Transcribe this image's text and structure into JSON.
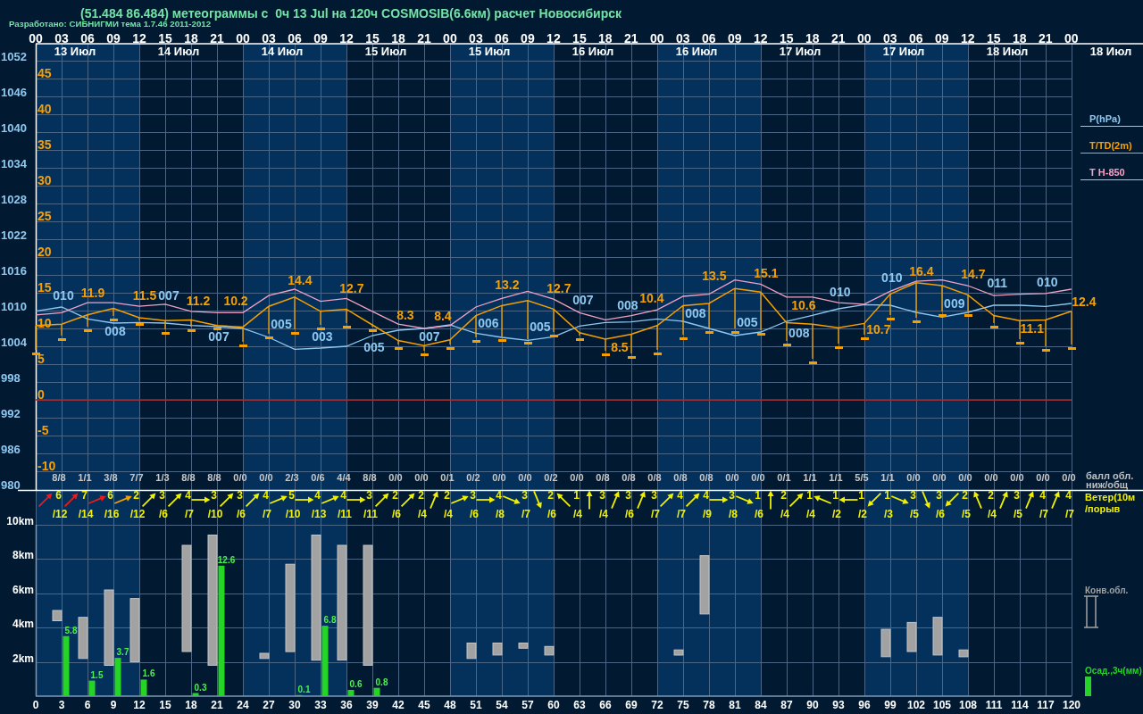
{
  "header": {
    "title": "(51.484 86.484) метеограммы с  0ч 13 Jul на 120ч COSMOSIB(6.6км) расчет Новосибирск",
    "credit": "Разработано: СИБНИГМИ тема 1.7.46 2011-2012"
  },
  "days": [
    {
      "label": "13 Июл",
      "shaded": true
    },
    {
      "label": "14 Июл",
      "shaded": false
    },
    {
      "label": "14 Июл",
      "shaded": true
    },
    {
      "label": "15 Июл",
      "shaded": false
    },
    {
      "label": "15 Июл",
      "shaded": true
    },
    {
      "label": "16 Июл",
      "shaded": false
    },
    {
      "label": "16 Июл",
      "shaded": true
    },
    {
      "label": "17 Июл",
      "shaded": false
    },
    {
      "label": "17 Июл",
      "shaded": true
    },
    {
      "label": "18 Июл",
      "shaded": false
    },
    {
      "label": "18 Июл",
      "shaded": false
    }
  ],
  "upper_panel": {
    "pressure_chart": {
      "chart_data": {
        "type": "line",
        "x": [
          0,
          3,
          6,
          9,
          12,
          15,
          18,
          21,
          24,
          27,
          30,
          33,
          36,
          39,
          42,
          45,
          48,
          51,
          54,
          57,
          60,
          63,
          66,
          69,
          72,
          75,
          78,
          81,
          84,
          87,
          90,
          93,
          96,
          99,
          102,
          105,
          108,
          111,
          114,
          117,
          120
        ],
        "xlim": [
          0,
          128.3
        ],
        "ylim": [
          980,
          1055
        ],
        "xticks": [
          {
            "value": 0,
            "label": "00"
          },
          {
            "value": 3,
            "label": "03"
          },
          {
            "value": 6,
            "label": "06"
          },
          {
            "value": 9,
            "label": "09"
          },
          {
            "value": 12,
            "label": "12"
          },
          {
            "value": 15,
            "label": "15"
          },
          {
            "value": 18,
            "label": "18"
          },
          {
            "value": 21,
            "label": "21"
          },
          {
            "value": 24,
            "label": "00"
          },
          {
            "value": 27,
            "label": "03"
          },
          {
            "value": 30,
            "label": "06"
          },
          {
            "value": 33,
            "label": "09"
          },
          {
            "value": 36,
            "label": "12"
          },
          {
            "value": 39,
            "label": "15"
          },
          {
            "value": 42,
            "label": "18"
          },
          {
            "value": 45,
            "label": "21"
          },
          {
            "value": 48,
            "label": "00"
          },
          {
            "value": 51,
            "label": "03"
          },
          {
            "value": 54,
            "label": "06"
          },
          {
            "value": 57,
            "label": "09"
          },
          {
            "value": 60,
            "label": "12"
          },
          {
            "value": 63,
            "label": "15"
          },
          {
            "value": 66,
            "label": "18"
          },
          {
            "value": 69,
            "label": "21"
          },
          {
            "value": 72,
            "label": "00"
          },
          {
            "value": 75,
            "label": "03"
          },
          {
            "value": 78,
            "label": "06"
          },
          {
            "value": 81,
            "label": "09"
          },
          {
            "value": 84,
            "label": "12"
          },
          {
            "value": 87,
            "label": "15"
          },
          {
            "value": 90,
            "label": "18"
          },
          {
            "value": 93,
            "label": "21"
          },
          {
            "value": 96,
            "label": "00"
          },
          {
            "value": 99,
            "label": "03"
          },
          {
            "value": 102,
            "label": "06"
          },
          {
            "value": 105,
            "label": "09"
          },
          {
            "value": 108,
            "label": "12"
          },
          {
            "value": 111,
            "label": "15"
          },
          {
            "value": 114,
            "label": "18"
          },
          {
            "value": 117,
            "label": "21"
          },
          {
            "value": 120,
            "label": "00"
          }
        ],
        "yticks": [
          980,
          986,
          992,
          998,
          1004,
          1010,
          1016,
          1022,
          1028,
          1034,
          1040,
          1046,
          1052
        ],
        "series": [
          {
            "name": "P(hPa)",
            "color": "#8ec8f0",
            "values": [
              1009.9,
              1010.6,
              1008.6,
              1007.9,
              1008.0,
              1007.9,
              1007.5,
              1007.3,
              1007.0,
              1005.5,
              1003.5,
              1003.7,
              1004.0,
              1005.8,
              1006.7,
              1007.0,
              1007.6,
              1006.2,
              1005.5,
              1005.0,
              1005.6,
              1007.4,
              1008.0,
              1008.1,
              1008.6,
              1008.2,
              1007.0,
              1005.8,
              1006.4,
              1008.2,
              1009.2,
              1010.3,
              1011.0,
              1010.9,
              1009.7,
              1008.9,
              1009.7,
              1010.9,
              1010.9,
              1010.7,
              1011.2
            ]
          }
        ],
        "annotations": [
          {
            "x": 3,
            "y": 1010.6,
            "text": "010"
          },
          {
            "x": 9,
            "y": 1007.9,
            "text": "008"
          },
          {
            "x": 15,
            "y": 1007.9,
            "text": "007"
          },
          {
            "x": 21,
            "y": 1007.3,
            "text": "007"
          },
          {
            "x": 27,
            "y": 1005.5,
            "text": "005"
          },
          {
            "x": 33,
            "y": 1003.7,
            "text": "003"
          },
          {
            "x": 39,
            "y": 1005.8,
            "text": "005"
          },
          {
            "x": 45,
            "y": 1007.0,
            "text": "007"
          },
          {
            "x": 51,
            "y": 1006.2,
            "text": "006"
          },
          {
            "x": 57,
            "y": 1005.0,
            "text": "005"
          },
          {
            "x": 63,
            "y": 1007.4,
            "text": "007"
          },
          {
            "x": 69,
            "y": 1008.1,
            "text": "008"
          },
          {
            "x": 75,
            "y": 1008.2,
            "text": "008"
          },
          {
            "x": 81,
            "y": 1005.8,
            "text": "005"
          },
          {
            "x": 87,
            "y": 1008.2,
            "text": "008"
          },
          {
            "x": 93,
            "y": 1010.3,
            "text": "010"
          },
          {
            "x": 99,
            "y": 1010.9,
            "text": "010"
          },
          {
            "x": 105,
            "y": 1008.9,
            "text": "009"
          },
          {
            "x": 111,
            "y": 1010.9,
            "text": "011"
          },
          {
            "x": 117,
            "y": 1010.7,
            "text": "010"
          }
        ]
      }
    },
    "temperature_chart": {
      "chart_data": {
        "type": "line",
        "x": [
          0,
          3,
          6,
          9,
          12,
          15,
          18,
          21,
          24,
          27,
          30,
          33,
          36,
          39,
          42,
          45,
          48,
          51,
          54,
          57,
          60,
          63,
          66,
          69,
          72,
          75,
          78,
          81,
          84,
          87,
          90,
          93,
          96,
          99,
          102,
          105,
          108,
          111,
          114,
          117,
          120
        ],
        "xlim": [
          0,
          128.3
        ],
        "ylim": [
          -12.5,
          50
        ],
        "yticks": [
          -10,
          -5,
          0,
          5,
          10,
          15,
          20,
          25,
          30,
          35,
          40,
          45
        ],
        "series": [
          {
            "name": "T/TD(2m)",
            "color": "#f5a000",
            "values": [
              10.4,
              10.6,
              11.9,
              12.8,
              11.5,
              11.1,
              11.2,
              10.4,
              10.2,
              13.1,
              14.4,
              12.4,
              12.7,
              10.5,
              8.3,
              7.6,
              8.4,
              11.8,
              13.2,
              13.9,
              12.7,
              9.4,
              8.5,
              9.2,
              10.4,
              13.2,
              13.5,
              15.6,
              15.1,
              10.8,
              10.6,
              10.1,
              10.7,
              14.8,
              16.4,
              16.0,
              14.7,
              11.8,
              11.1,
              11.2,
              12.4
            ]
          },
          {
            "name": "T H-850",
            "color": "#f2a2c2",
            "values": [
              11.9,
              12.2,
              13.6,
              13.6,
              13.1,
              13.4,
              12.4,
              12.2,
              12.2,
              14.6,
              15.5,
              13.8,
              14.2,
              12.4,
              10.6,
              10.0,
              10.4,
              13.0,
              14.2,
              15.2,
              14.1,
              12.2,
              11.2,
              11.8,
              12.6,
              14.5,
              14.8,
              16.8,
              16.2,
              14.4,
              14.4,
              13.6,
              13.4,
              15.2,
              16.6,
              16.8,
              16.0,
              14.6,
              14.8,
              14.9,
              15.5
            ]
          },
          {
            "type": "scatter",
            "color": "#f5a000",
            "values": [
              6.5,
              8.5,
              9.8,
              11.2,
              10.6,
              9.4,
              9.8,
              10.0,
              7.6,
              8.8,
              9.4,
              10.0,
              10.2,
              9.8,
              7.2,
              6.4,
              7.2,
              8.2,
              8.4,
              8.0,
              9.0,
              8.5,
              6.4,
              6.0,
              6.5,
              8.6,
              9.5,
              9.5,
              9.2,
              7.8,
              5.2,
              7.4,
              8.6,
              11.4,
              11.0,
              11.9,
              11.9,
              10.2,
              8.0,
              7.0,
              7.2
            ]
          }
        ],
        "ref_lines": [
          {
            "axis": "y",
            "value": 0
          }
        ],
        "annotations": [
          {
            "x": 6,
            "y": 11.9,
            "text": "11.9"
          },
          {
            "x": 12,
            "y": 11.5,
            "text": "11.5"
          },
          {
            "x": 18,
            "y": 11.2,
            "text": "11.2"
          },
          {
            "x": 24,
            "y": 10.2,
            "text": "10.2"
          },
          {
            "x": 30,
            "y": 14.4,
            "text": "14.4"
          },
          {
            "x": 36,
            "y": 12.7,
            "text": "12.7"
          },
          {
            "x": 42,
            "y": 8.3,
            "text": "8.3"
          },
          {
            "x": 48,
            "y": 8.4,
            "text": "8.4"
          },
          {
            "x": 54,
            "y": 13.2,
            "text": "13.2"
          },
          {
            "x": 60,
            "y": 12.7,
            "text": "12.7"
          },
          {
            "x": 66,
            "y": 8.5,
            "text": "8.5"
          },
          {
            "x": 72,
            "y": 10.4,
            "text": "10.4"
          },
          {
            "x": 78,
            "y": 13.5,
            "text": "13.5"
          },
          {
            "x": 84,
            "y": 15.1,
            "text": "15.1"
          },
          {
            "x": 90,
            "y": 10.6,
            "text": "10.6"
          },
          {
            "x": 96,
            "y": 10.7,
            "text": "10.7"
          },
          {
            "x": 102,
            "y": 16.4,
            "text": "16.4"
          },
          {
            "x": 108,
            "y": 14.7,
            "text": "14.7"
          },
          {
            "x": 114,
            "y": 11.1,
            "text": "11.1"
          },
          {
            "x": 120,
            "y": 12.4,
            "text": "12.4"
          }
        ]
      }
    }
  },
  "cloud_cover": {
    "legend": [
      "балл обл.",
      "ниж/общ"
    ],
    "values": [
      "8/8",
      "1/1",
      "3/8",
      "7/7",
      "1/3",
      "8/8",
      "8/8",
      "0/0",
      "0/0",
      "2/3",
      "0/6",
      "4/4",
      "8/8",
      "0/0",
      "0/0",
      "0/1",
      "0/2",
      "0/0",
      "0/0",
      "0/2",
      "0/0",
      "0/8",
      "0/8",
      "0/8",
      "0/8",
      "0/8",
      "0/0",
      "0/0",
      "0/1",
      "1/1",
      "1/1",
      "5/5",
      "1/1",
      "0/0",
      "0/0",
      "0/0",
      "0/0",
      "0/0",
      "0/0",
      "0/0"
    ]
  },
  "wind": {
    "legend": [
      "Ветер(10м",
      "/порыв"
    ],
    "items": [
      {
        "speed": "6",
        "gust": "/12",
        "kind": "ne",
        "color": "#e81c1c"
      },
      {
        "speed": "7",
        "gust": "/14",
        "kind": "ne",
        "color": "#e81c1c"
      },
      {
        "speed": "6",
        "gust": "/16",
        "kind": "ene",
        "color": "#e81c1c"
      },
      {
        "speed": "2",
        "gust": "/12",
        "kind": "ene",
        "color": "#f4a000"
      },
      {
        "speed": "3",
        "gust": "/6",
        "kind": "ne",
        "color": "#f0f000"
      },
      {
        "speed": "4",
        "gust": "/7",
        "kind": "ne",
        "color": "#f0f000"
      },
      {
        "speed": "3",
        "gust": "/10",
        "kind": "e",
        "color": "#f0f000"
      },
      {
        "speed": "3",
        "gust": "/6",
        "kind": "ne",
        "color": "#f0f000"
      },
      {
        "speed": "4",
        "gust": "/7",
        "kind": "ne",
        "color": "#f0f000"
      },
      {
        "speed": "5",
        "gust": "/10",
        "kind": "ene",
        "color": "#f0f000"
      },
      {
        "speed": "4",
        "gust": "/13",
        "kind": "e",
        "color": "#f0f000"
      },
      {
        "speed": "4",
        "gust": "/11",
        "kind": "ene",
        "color": "#f0f000"
      },
      {
        "speed": "3",
        "gust": "/11",
        "kind": "e",
        "color": "#f0f000"
      },
      {
        "speed": "2",
        "gust": "/6",
        "kind": "ne",
        "color": "#f0f000"
      },
      {
        "speed": "2",
        "gust": "/4",
        "kind": "ne",
        "color": "#f0f000"
      },
      {
        "speed": "2",
        "gust": "/4",
        "kind": "nne",
        "color": "#f0f000"
      },
      {
        "speed": "3",
        "gust": "/6",
        "kind": "ene",
        "color": "#f0f000"
      },
      {
        "speed": "4",
        "gust": "/8",
        "kind": "e",
        "color": "#f0f000"
      },
      {
        "speed": "3",
        "gust": "/7",
        "kind": "ese",
        "color": "#f0f000"
      },
      {
        "speed": "2",
        "gust": "/6",
        "kind": "sse",
        "color": "#f0f000"
      },
      {
        "speed": "1",
        "gust": "/4",
        "kind": "nw",
        "color": "#f0f000"
      },
      {
        "speed": "3",
        "gust": "/4",
        "kind": "n",
        "color": "#f0f000"
      },
      {
        "speed": "3",
        "gust": "/6",
        "kind": "nne",
        "color": "#f0f000"
      },
      {
        "speed": "3",
        "gust": "/7",
        "kind": "nne",
        "color": "#f0f000"
      },
      {
        "speed": "4",
        "gust": "/7",
        "kind": "ne",
        "color": "#f0f000"
      },
      {
        "speed": "4",
        "gust": "/9",
        "kind": "ne",
        "color": "#f0f000"
      },
      {
        "speed": "3",
        "gust": "/8",
        "kind": "e",
        "color": "#f0f000"
      },
      {
        "speed": "1",
        "gust": "/6",
        "kind": "ese",
        "color": "#f0f000"
      },
      {
        "speed": "2",
        "gust": "/4",
        "kind": "n",
        "color": "#f0f000"
      },
      {
        "speed": "1",
        "gust": "/4",
        "kind": "ne",
        "color": "#f0f000"
      },
      {
        "speed": "1",
        "gust": "/2",
        "kind": "wnw",
        "color": "#f0f000"
      },
      {
        "speed": "1",
        "gust": "/2",
        "kind": "w",
        "color": "#f0f000"
      },
      {
        "speed": "1",
        "gust": "/3",
        "kind": "sw",
        "color": "#f0f000"
      },
      {
        "speed": "3",
        "gust": "/5",
        "kind": "ese",
        "color": "#f0f000"
      },
      {
        "speed": "3",
        "gust": "/6",
        "kind": "sse",
        "color": "#f0f000"
      },
      {
        "speed": "2",
        "gust": "/5",
        "kind": "sw",
        "color": "#f0f000"
      },
      {
        "speed": "2",
        "gust": "/4",
        "kind": "nnw",
        "color": "#f0f000"
      },
      {
        "speed": "3",
        "gust": "/5",
        "kind": "nne",
        "color": "#f0f000"
      },
      {
        "speed": "4",
        "gust": "/7",
        "kind": "nne",
        "color": "#f0f000"
      },
      {
        "speed": "4",
        "gust": "/7",
        "kind": "nne",
        "color": "#f0f000"
      }
    ]
  },
  "lower_panel": {
    "cloud_chart": {
      "chart_data": {
        "type": "candlestick",
        "categories": [
          null,
          null,
          null,
          null,
          null,
          null,
          null,
          null,
          null,
          null,
          null,
          null,
          null,
          null,
          null,
          null,
          null,
          null,
          null,
          null,
          null,
          null,
          null,
          null,
          null,
          null,
          null,
          null,
          null,
          null,
          null,
          null,
          null,
          null,
          null,
          null,
          null,
          null,
          null,
          null,
          null
        ],
        "ylim": [
          0,
          10
        ],
        "yticks": [
          {
            "value": 2,
            "label": "2km"
          },
          {
            "value": 4,
            "label": "4km"
          },
          {
            "value": 6,
            "label": "6km"
          },
          {
            "value": 8,
            "label": "8km"
          },
          {
            "value": 10,
            "label": "10km"
          }
        ],
        "series": [
          {
            "name": "Конв.обл.",
            "color": "#a2a2a2",
            "ohlc": [
              null,
              [
                4.4,
                5.0,
                4.4,
                5.0
              ],
              [
                2.2,
                4.6,
                2.2,
                4.6
              ],
              [
                1.8,
                6.2,
                1.8,
                6.2
              ],
              [
                2.0,
                5.7,
                2.0,
                5.7
              ],
              null,
              [
                2.6,
                8.8,
                2.6,
                8.8
              ],
              [
                1.8,
                9.4,
                1.8,
                9.4
              ],
              null,
              [
                2.2,
                2.5,
                2.2,
                2.5
              ],
              [
                2.6,
                7.7,
                2.6,
                7.7
              ],
              [
                2.1,
                9.4,
                2.1,
                9.4
              ],
              [
                2.1,
                8.8,
                2.1,
                8.8
              ],
              [
                1.8,
                8.8,
                1.8,
                8.8
              ],
              null,
              null,
              null,
              [
                2.2,
                3.1,
                2.2,
                3.1
              ],
              [
                2.4,
                3.1,
                2.4,
                3.1
              ],
              [
                2.8,
                3.1,
                2.8,
                3.1
              ],
              [
                2.4,
                2.9,
                2.4,
                2.9
              ],
              null,
              null,
              null,
              null,
              [
                2.4,
                2.7,
                2.4,
                2.7
              ],
              [
                4.8,
                8.2,
                4.8,
                8.2
              ],
              null,
              null,
              null,
              null,
              null,
              null,
              [
                2.3,
                3.9,
                2.3,
                3.9
              ],
              [
                2.6,
                4.3,
                2.6,
                4.3
              ],
              [
                2.4,
                4.6,
                2.4,
                4.6
              ],
              [
                2.3,
                2.7,
                2.3,
                2.7
              ],
              null,
              null,
              null,
              null
            ]
          }
        ]
      }
    },
    "precipitation_chart": {
      "chart_data": {
        "type": "bar",
        "categories": [
          "0",
          "3",
          "6",
          "9",
          "12",
          "15",
          "18",
          "21",
          "24",
          "27",
          "30",
          "33",
          "36",
          "39",
          "42",
          "45",
          "48",
          "51",
          "54",
          "57",
          "60",
          "63",
          "66",
          "69",
          "72",
          "75",
          "78",
          "81",
          "84",
          "87",
          "90",
          "93",
          "96",
          "99",
          "102",
          "105",
          "108",
          "111",
          "114",
          "117",
          "120"
        ],
        "data_labels": true,
        "series": [
          {
            "name": "Осад.,3ч(мм)",
            "color": "#26d426",
            "values": [
              null,
              5.8,
              1.5,
              3.7,
              1.6,
              null,
              0.3,
              12.6,
              null,
              null,
              0.1,
              6.8,
              0.6,
              0.8,
              null,
              null,
              null,
              null,
              null,
              null,
              null,
              null,
              null,
              null,
              null,
              null,
              null,
              null,
              null,
              null,
              null,
              null,
              null,
              null,
              null,
              null,
              null,
              null,
              null,
              null,
              null
            ]
          }
        ]
      }
    }
  }
}
